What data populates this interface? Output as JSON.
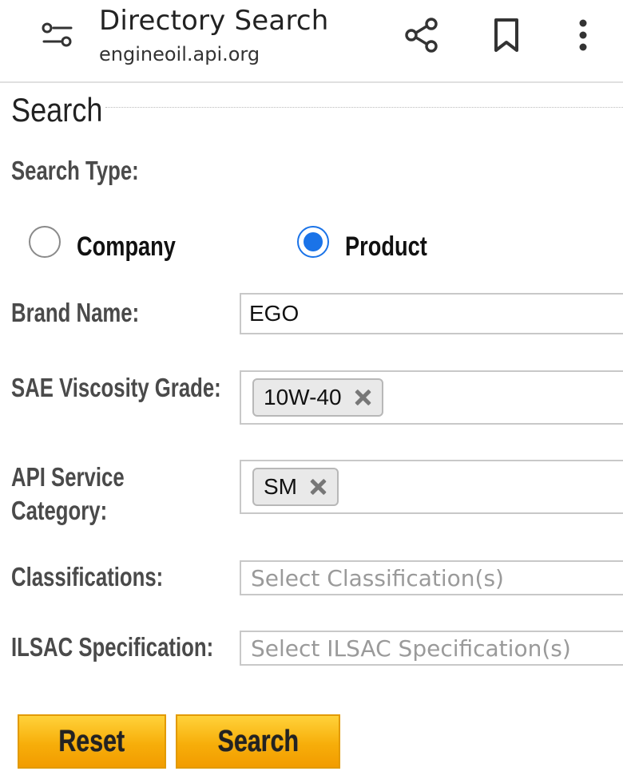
{
  "browser": {
    "title": "Directory Search",
    "url": "engineoil.api.org",
    "icons": {
      "filter": "tune-sliders-icon",
      "share": "share-icon",
      "bookmark": "bookmark-icon",
      "more": "more-vertical-icon"
    }
  },
  "form": {
    "section_title": "Search",
    "search_type": {
      "label": "Search Type:",
      "options": [
        {
          "label": "Company",
          "selected": false
        },
        {
          "label": "Product",
          "selected": true
        }
      ]
    },
    "brand_name": {
      "label": "Brand Name:",
      "value": "EGO"
    },
    "sae_viscosity": {
      "label": "SAE Viscosity Grade:",
      "tags": [
        "10W-40"
      ]
    },
    "api_service": {
      "label_line1": "API Service",
      "label_line2": "Category:",
      "tags": [
        "SM"
      ]
    },
    "classifications": {
      "label": "Classifications:",
      "placeholder": "Select Classification(s)"
    },
    "ilsac": {
      "label": "ILSAC Specification:",
      "placeholder": "Select ILSAC Specification(s)"
    },
    "buttons": {
      "reset": "Reset",
      "search": "Search"
    }
  },
  "colors": {
    "accent": "#1a73e8",
    "button": "#f7ae0a"
  }
}
